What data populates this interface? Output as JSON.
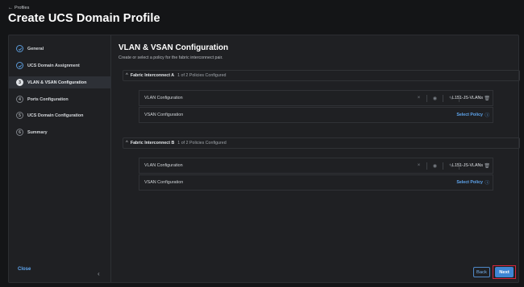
{
  "breadcrumb": {
    "arrow": "←",
    "label": "Profiles"
  },
  "page_title": "Create UCS Domain Profile",
  "steps": [
    {
      "num": "",
      "label": "General",
      "state": "done"
    },
    {
      "num": "",
      "label": "UCS Domain Assignment",
      "state": "done"
    },
    {
      "num": "3",
      "label": "VLAN & VSAN Configuration",
      "state": "current"
    },
    {
      "num": "4",
      "label": "Ports Configuration",
      "state": "pending"
    },
    {
      "num": "5",
      "label": "UCS Domain Configuration",
      "state": "pending"
    },
    {
      "num": "6",
      "label": "Summary",
      "state": "pending"
    }
  ],
  "collapse_icon": "‹",
  "main": {
    "heading": "VLAN & VSAN Configuration",
    "subheading": "Create or select a policy for the fabric interconnect pair."
  },
  "fabric_a": {
    "chevron": "^",
    "title": "Fabric Interconnect A",
    "count": "1 of 2 Policies Configured",
    "vlan": {
      "label": "VLAN Configuration",
      "policy": "L151-JS-VLANs"
    },
    "vsan": {
      "label": "VSAN Configuration",
      "select": "Select Policy"
    }
  },
  "fabric_b": {
    "chevron": "^",
    "title": "Fabric Interconnect B",
    "count": "1 of 2 Policies Configured",
    "vlan": {
      "label": "VLAN Configuration",
      "policy": "L151-JS-VLANs"
    },
    "vsan": {
      "label": "VSAN Configuration",
      "select": "Select Policy"
    }
  },
  "icons": {
    "clear": "×",
    "view": "◉",
    "edit": "✎",
    "trash": "🗑",
    "info": "ⓘ"
  },
  "footer": {
    "close": "Close",
    "back": "Back",
    "next": "Next"
  },
  "colors": {
    "accent": "#3e86d4",
    "link": "#5fa6ef",
    "highlight": "#d7263d",
    "background": "#141517"
  }
}
